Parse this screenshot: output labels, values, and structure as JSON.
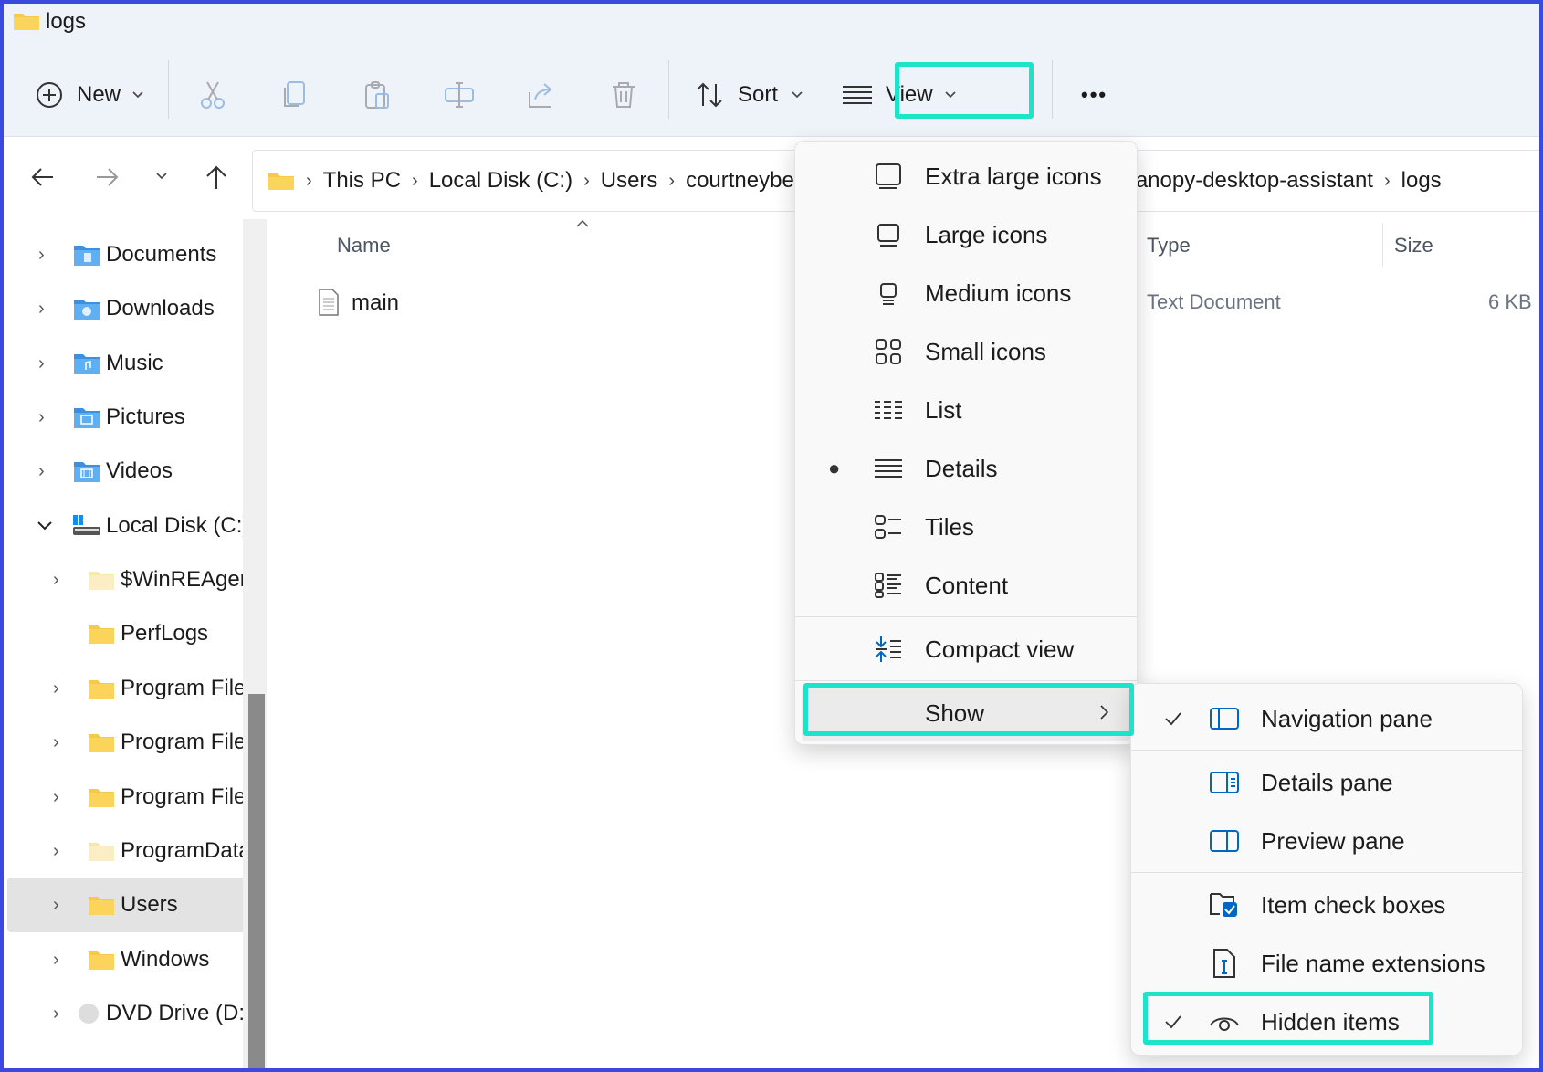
{
  "window": {
    "title": "logs"
  },
  "toolbar": {
    "new_label": "New",
    "sort_label": "Sort",
    "view_label": "View",
    "more_label": "•••"
  },
  "address": {
    "crumbs": [
      "This PC",
      "Local Disk (C:)",
      "Users",
      "courtneybe",
      "canopy-desktop-assistant",
      "logs"
    ]
  },
  "sidebar": {
    "items": [
      {
        "label": "Documents"
      },
      {
        "label": "Downloads"
      },
      {
        "label": "Music"
      },
      {
        "label": "Pictures"
      },
      {
        "label": "Videos"
      },
      {
        "label": "Local Disk (C:)"
      },
      {
        "label": "$WinREAgen"
      },
      {
        "label": "PerfLogs"
      },
      {
        "label": "Program File"
      },
      {
        "label": "Program File"
      },
      {
        "label": "Program File"
      },
      {
        "label": "ProgramData"
      },
      {
        "label": "Users"
      },
      {
        "label": "Windows"
      },
      {
        "label": "DVD Drive (D:)"
      }
    ]
  },
  "columns": {
    "name": "Name",
    "type": "Type",
    "size": "Size"
  },
  "files": [
    {
      "name": "main",
      "type": "Text Document",
      "size": "6 KB"
    }
  ],
  "view_menu": {
    "items": [
      {
        "label": "Extra large icons"
      },
      {
        "label": "Large icons"
      },
      {
        "label": "Medium icons"
      },
      {
        "label": "Small icons"
      },
      {
        "label": "List"
      },
      {
        "label": "Details",
        "selected": true
      },
      {
        "label": "Tiles"
      },
      {
        "label": "Content"
      },
      {
        "label": "Compact view"
      },
      {
        "label": "Show"
      }
    ]
  },
  "show_menu": {
    "items": [
      {
        "label": "Navigation pane",
        "checked": true
      },
      {
        "label": "Details pane",
        "checked": false
      },
      {
        "label": "Preview pane",
        "checked": false
      },
      {
        "label": "Item check boxes",
        "checked": false
      },
      {
        "label": "File name extensions",
        "checked": false
      },
      {
        "label": "Hidden items",
        "checked": true
      }
    ]
  },
  "colors": {
    "highlight": "#1de3c9",
    "frame": "#3b49df",
    "folder": "#f7c948",
    "accent": "#0067c0"
  }
}
